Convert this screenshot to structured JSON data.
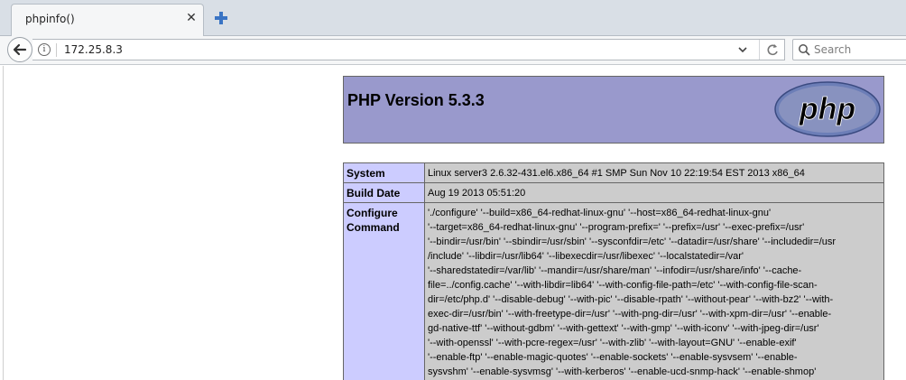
{
  "browser": {
    "tab": {
      "title": "phpinfo()"
    },
    "url": "172.25.8.3",
    "search_placeholder": "Search"
  },
  "php": {
    "version_title": "PHP Version 5.3.3",
    "logo_text": "php"
  },
  "info_rows": [
    {
      "key": "System",
      "value": "Linux server3 2.6.32-431.el6.x86_64 #1 SMP Sun Nov 10 22:19:54 EST 2013 x86_64"
    },
    {
      "key": "Build Date",
      "value": "Aug 19 2013 05:51:20"
    },
    {
      "key": "Configure\nCommand",
      "lines": [
        "'./configure' '--build=x86_64-redhat-linux-gnu' '--host=x86_64-redhat-linux-gnu'",
        "'--target=x86_64-redhat-linux-gnu' '--program-prefix=' '--prefix=/usr' '--exec-prefix=/usr'",
        "'--bindir=/usr/bin' '--sbindir=/usr/sbin' '--sysconfdir=/etc' '--datadir=/usr/share' '--includedir=/usr",
        "/include' '--libdir=/usr/lib64' '--libexecdir=/usr/libexec' '--localstatedir=/var'",
        "'--sharedstatedir=/var/lib' '--mandir=/usr/share/man' '--infodir=/usr/share/info' '--cache-",
        "file=../config.cache' '--with-libdir=lib64' '--with-config-file-path=/etc' '--with-config-file-scan-",
        "dir=/etc/php.d' '--disable-debug' '--with-pic' '--disable-rpath' '--without-pear' '--with-bz2' '--with-",
        "exec-dir=/usr/bin' '--with-freetype-dir=/usr' '--with-png-dir=/usr' '--with-xpm-dir=/usr' '--enable-",
        "gd-native-ttf' '--without-gdbm' '--with-gettext' '--with-gmp' '--with-iconv' '--with-jpeg-dir=/usr'",
        "'--with-openssl' '--with-pcre-regex=/usr' '--with-zlib' '--with-layout=GNU' '--enable-exif'",
        "'--enable-ftp' '--enable-magic-quotes' '--enable-sockets' '--enable-sysvsem' '--enable-",
        "sysvshm' '--enable-sysvmsg' '--with-kerberos' '--enable-ucd-snmp-hack' '--enable-shmop'"
      ]
    }
  ]
}
